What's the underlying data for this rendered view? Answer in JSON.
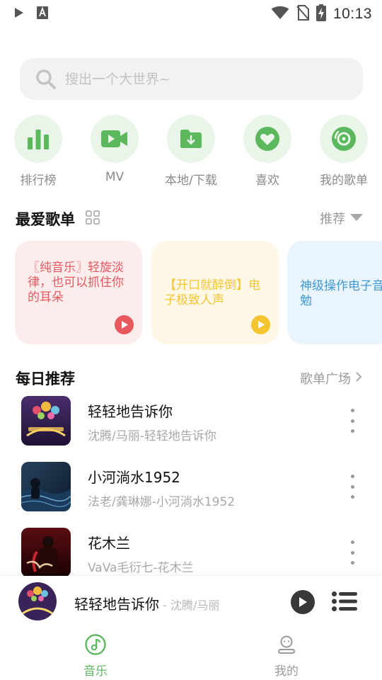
{
  "status_bar": {
    "time": "10:13"
  },
  "search": {
    "placeholder": "搜出一个大世界~"
  },
  "categories": [
    {
      "label": "排行榜",
      "icon": "bar-chart-icon"
    },
    {
      "label": "MV",
      "icon": "video-camera-icon"
    },
    {
      "label": "本地/下载",
      "icon": "folder-download-icon"
    },
    {
      "label": "喜欢",
      "icon": "heart-icon"
    },
    {
      "label": "我的歌单",
      "icon": "disc-icon"
    }
  ],
  "favorites": {
    "title": "最爱歌单",
    "sort_label": "推荐",
    "cards": [
      {
        "text": "〖纯音乐〗轻旋淡律，也可以抓住你的耳朵",
        "color": "#e8585f",
        "bg": "#fdecec"
      },
      {
        "text": "【开口就醉倒】电子极致人声",
        "color": "#f5c531",
        "bg": "#fff8e6"
      },
      {
        "text": "神级操作电子音与君共勉",
        "color": "#3f9ad8",
        "bg": "#eaf4fc"
      }
    ]
  },
  "daily": {
    "title": "每日推荐",
    "more_label": "歌单广场",
    "songs": [
      {
        "title": "轻轻地告诉你",
        "subtitle": "沈腾/马丽-轻轻地告诉你"
      },
      {
        "title": "小河淌水1952",
        "subtitle": "法老/龚琳娜-小河淌水1952"
      },
      {
        "title": "花木兰",
        "subtitle": "VaVa毛衍七-花木兰"
      }
    ]
  },
  "player": {
    "title": "轻轻地告诉你",
    "artist": " - 沈腾/马丽"
  },
  "nav": [
    {
      "label": "音乐",
      "active": true
    },
    {
      "label": "我的",
      "active": false
    }
  ],
  "colors": {
    "accent": "#5cb85c",
    "category_bg": "#eaf5ea"
  }
}
